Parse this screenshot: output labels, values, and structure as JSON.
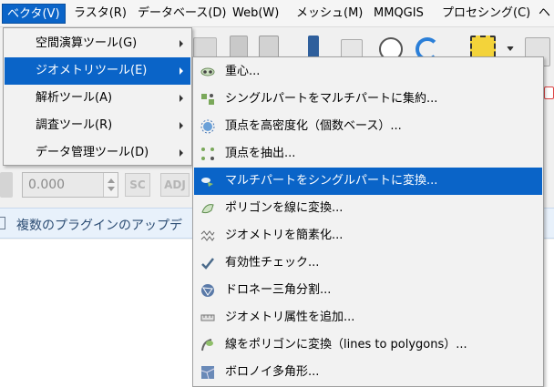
{
  "menubar": {
    "items": [
      {
        "label": "ベクタ(V)",
        "active": true
      },
      {
        "label": "ラスタ(R)"
      },
      {
        "label": "データベース(D)"
      },
      {
        "label": "Web(W)"
      },
      {
        "label": "メッシュ(M)"
      },
      {
        "label": "MMQGIS"
      },
      {
        "label": "プロセシング(C)"
      },
      {
        "label": "ヘ"
      }
    ]
  },
  "vector_menu": {
    "items": [
      {
        "label": "空間演算ツール(G)"
      },
      {
        "label": "ジオメトリツール(E)",
        "active": true
      },
      {
        "label": "解析ツール(A)"
      },
      {
        "label": "調査ツール(R)"
      },
      {
        "label": "データ管理ツール(D)"
      }
    ]
  },
  "geometry_submenu": {
    "items": [
      {
        "label": "重心...",
        "icon": "centroid-icon"
      },
      {
        "label": "シングルパートをマルチパートに集約...",
        "icon": "collect-icon"
      },
      {
        "label": "頂点を高密度化（個数ベース）...",
        "icon": "densify-icon"
      },
      {
        "label": "頂点を抽出...",
        "icon": "extract-vertices-icon"
      },
      {
        "label": "マルチパートをシングルパートに変換...",
        "icon": "multipart-to-single-icon",
        "active": true
      },
      {
        "label": "ポリゴンを線に変換...",
        "icon": "polygon-to-line-icon"
      },
      {
        "label": "ジオメトリを簡素化...",
        "icon": "simplify-icon"
      },
      {
        "label": "有効性チェック...",
        "icon": "check-validity-icon"
      },
      {
        "label": "ドロネー三角分割...",
        "icon": "delaunay-icon"
      },
      {
        "label": "ジオメトリ属性を追加...",
        "icon": "add-geometry-attributes-icon"
      },
      {
        "label": "線をポリゴンに変換（lines to polygons）...",
        "icon": "line-to-polygon-icon"
      },
      {
        "label": "ボロノイ多角形...",
        "icon": "voronoi-icon"
      }
    ]
  },
  "toolbar": {
    "spin_value": "0.000",
    "chip_sc": "SC",
    "chip_adj": "ADJ"
  },
  "notification": {
    "text": "複数のプラグインのアップデ"
  },
  "colors": {
    "accent": "#0a64c8",
    "menu_bg": "#f2f2f2"
  }
}
